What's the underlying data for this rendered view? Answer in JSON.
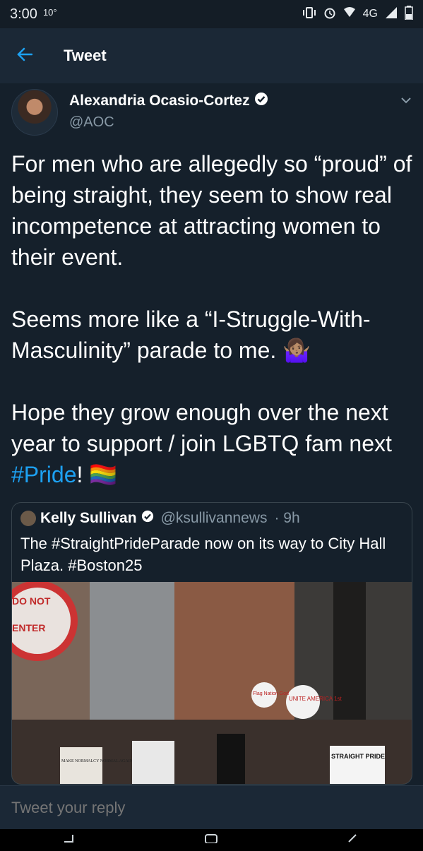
{
  "status_bar": {
    "time": "3:00",
    "temp": "10°",
    "network": "4G"
  },
  "header": {
    "title": "Tweet"
  },
  "tweet": {
    "author_name": "Alexandria Ocasio-Cortez",
    "handle": "@AOC",
    "paragraphs": [
      "For men who are allegedly so “proud” of being straight, they seem to show real incompetence at attracting women to their event.",
      "Seems more like a “I-Struggle-With-Masculinity” parade to me. 🤷🏽‍♀️",
      "Hope they grow enough over the next year to support / join LGBTQ fam next "
    ],
    "hashtag": "#Pride",
    "after_hashtag": "! 🏳️‍🌈"
  },
  "quoted": {
    "author_name": "Kelly Sullivan",
    "handle": "@ksullivannews",
    "time": "· 9h",
    "text": "The #StraightPrideParade now on its way to City Hall Plaza. #Boston25",
    "image_signs": [
      "DO NOT",
      "ENTER",
      "UNITE AMERICA 1st",
      "STRAIGHT PRIDE",
      "MAKE NORMALCY NORMAL AGAIN",
      "Flag Nation God"
    ]
  },
  "reply": {
    "placeholder": "Tweet your reply"
  },
  "colors": {
    "background": "#15202b",
    "accent": "#1da1f2",
    "secondary_text": "#8899a6",
    "border": "#38444d"
  }
}
